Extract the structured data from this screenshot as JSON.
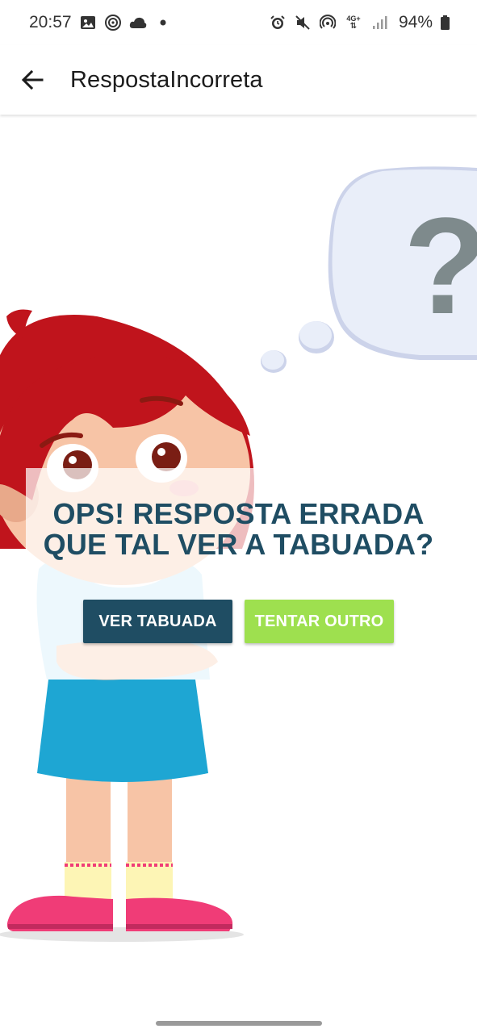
{
  "status_bar": {
    "time": "20:57",
    "left_icons": [
      "image-icon",
      "fingerprint-ring-icon",
      "cloud-icon",
      "dot-icon"
    ],
    "right_icons": [
      "alarm-icon",
      "mute-icon",
      "hotspot-icon",
      "4g-icon",
      "signal-icon"
    ],
    "network_label": "4G+",
    "battery": "94%"
  },
  "app_bar": {
    "title": "RespostaIncorreta",
    "back_icon": "arrow-left-icon"
  },
  "illustration": {
    "thought_bubble_symbol": "?",
    "colors": {
      "hair": "#c0141c",
      "skin": "#f7c4a6",
      "shirt": "#bfe7f6",
      "skirt": "#1ea6d3",
      "shoes": "#f03c77",
      "bubble": "#e9eef9",
      "question_mark": "#7e8a8c"
    }
  },
  "message": {
    "line1": "OPS! RESPOSTA ERRADA",
    "line2": "QUE TAL VER A TABUADA?",
    "color": "#1f4d63"
  },
  "buttons": {
    "view_table": {
      "label": "VER TABUADA",
      "color": "#1f4d63"
    },
    "try_another": {
      "label": "TENTAR OUTRO",
      "color": "#9ee04f"
    }
  }
}
